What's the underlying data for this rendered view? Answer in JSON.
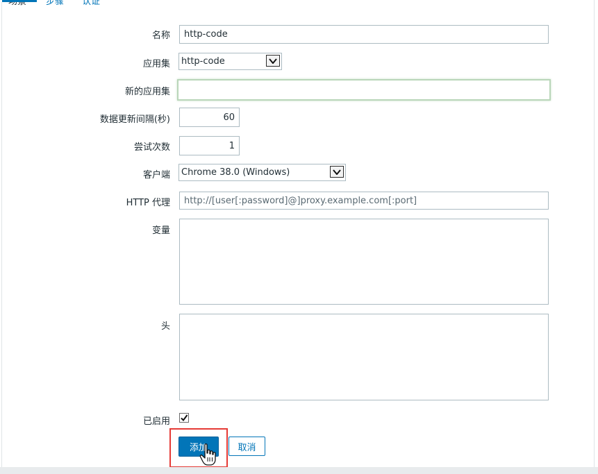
{
  "tabs": [
    "场景",
    "步骤",
    "认证"
  ],
  "form": {
    "name": {
      "label": "名称",
      "value": "http-code"
    },
    "application": {
      "label": "应用集",
      "selected": "http-code"
    },
    "new_application": {
      "label": "新的应用集",
      "value": ""
    },
    "update_interval": {
      "label": "数据更新间隔(秒)",
      "value": "60"
    },
    "attempts": {
      "label": "尝试次数",
      "value": "1"
    },
    "agent": {
      "label": "客户端",
      "selected": "Chrome 38.0 (Windows)"
    },
    "http_proxy": {
      "label": "HTTP 代理",
      "placeholder": "http://[user[:password]@]proxy.example.com[:port]"
    },
    "variables": {
      "label": "变量",
      "value": ""
    },
    "headers": {
      "label": "头",
      "value": ""
    },
    "enabled": {
      "label": "已启用",
      "checked": true
    }
  },
  "buttons": {
    "add": "添加",
    "cancel": "取消"
  },
  "colors": {
    "accent": "#0275b8",
    "highlight": "#e53935",
    "focus_border": "#b9d6b9"
  }
}
